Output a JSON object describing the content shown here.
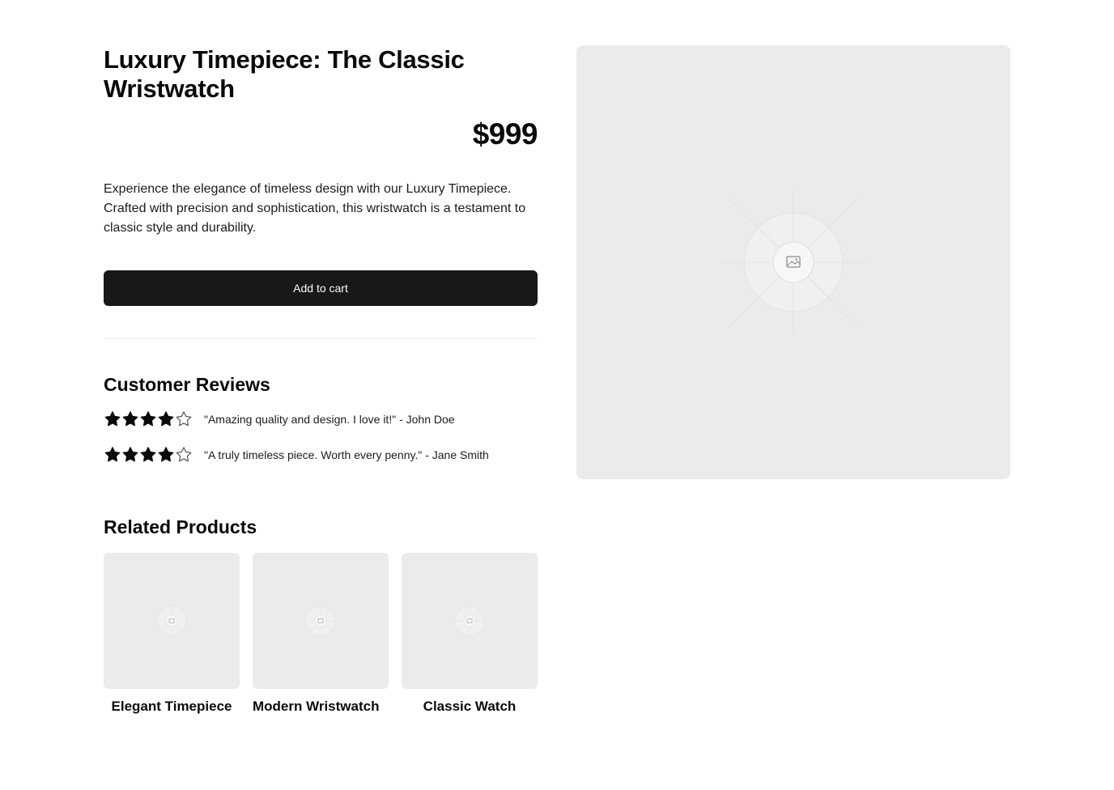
{
  "product": {
    "title": "Luxury Timepiece: The Classic Wristwatch",
    "price": "$999",
    "description": "Experience the elegance of timeless design with our Luxury Timepiece. Crafted with precision and sophistication, this wristwatch is a testament to classic style and durability.",
    "add_to_cart_label": "Add to cart",
    "image_icon": "image-placeholder-icon"
  },
  "reviews": {
    "heading": "Customer Reviews",
    "items": [
      {
        "rating": 4,
        "max": 5,
        "text": "\"Amazing quality and design. I love it!\" - John Doe"
      },
      {
        "rating": 4,
        "max": 5,
        "text": "\"A truly timeless piece. Worth every penny.\" - Jane Smith"
      }
    ]
  },
  "related": {
    "heading": "Related Products",
    "items": [
      {
        "name": "Elegant Timepiece"
      },
      {
        "name": "Modern Wristwatch"
      },
      {
        "name": "Classic Watch"
      }
    ]
  },
  "colors": {
    "button_bg": "#18181b",
    "button_text": "#fafafa",
    "placeholder_bg": "#ebebeb",
    "star_filled": "#0a0a0a",
    "star_empty_stroke": "#555555"
  }
}
